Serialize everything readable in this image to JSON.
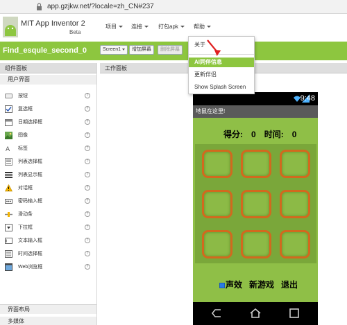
{
  "browser": {
    "url": "app.gzjkw.net/?locale=zh_CN#237"
  },
  "app": {
    "name": "MIT App Inventor 2",
    "beta": "Beta"
  },
  "menus": [
    {
      "label": "项目"
    },
    {
      "label": "连接"
    },
    {
      "label": "打包apk"
    },
    {
      "label": "帮助"
    }
  ],
  "project": {
    "name": "Find_esqule_second_0",
    "screen_select": "Screen1",
    "add_screen": "增加屏幕",
    "remove_screen": "删除屏幕"
  },
  "help_menu": {
    "items": [
      {
        "label": "关于"
      },
      {
        "label": "AI同伴信息"
      },
      {
        "label": "更新伴侣"
      },
      {
        "label": "Show Splash Screen"
      }
    ]
  },
  "palette": {
    "title": "组件面板",
    "ui_section": "用户界面",
    "components": [
      {
        "label": "按钮",
        "icon": "button-icon"
      },
      {
        "label": "复选框",
        "icon": "checkbox-icon"
      },
      {
        "label": "日期选择框",
        "icon": "date-picker-icon"
      },
      {
        "label": "图像",
        "icon": "image-icon"
      },
      {
        "label": "标签",
        "icon": "label-icon"
      },
      {
        "label": "列表选择框",
        "icon": "list-picker-icon"
      },
      {
        "label": "列表显示框",
        "icon": "list-view-icon"
      },
      {
        "label": "对话框",
        "icon": "notifier-icon"
      },
      {
        "label": "密码输入框",
        "icon": "password-icon"
      },
      {
        "label": "滑动条",
        "icon": "slider-icon"
      },
      {
        "label": "下拉框",
        "icon": "spinner-icon"
      },
      {
        "label": "文本输入框",
        "icon": "textbox-icon"
      },
      {
        "label": "时间选择框",
        "icon": "time-picker-icon"
      },
      {
        "label": "Web浏览框",
        "icon": "webviewer-icon"
      }
    ],
    "layout_section": "界面布局",
    "media_section": "多媒体"
  },
  "viewer": {
    "title": "工作面板"
  },
  "phone": {
    "time": "9:48",
    "title": "地鼠在这里!",
    "score_label": "得分:",
    "score_value": "0",
    "time_label": "时间:",
    "time_value": "0",
    "sound_label": "声效",
    "new_game_label": "新游戏",
    "exit_label": "退出"
  },
  "colors": {
    "accent": "#8dc63f",
    "hole_border": "#d2691e",
    "annotation_arrow": "#e02020"
  }
}
